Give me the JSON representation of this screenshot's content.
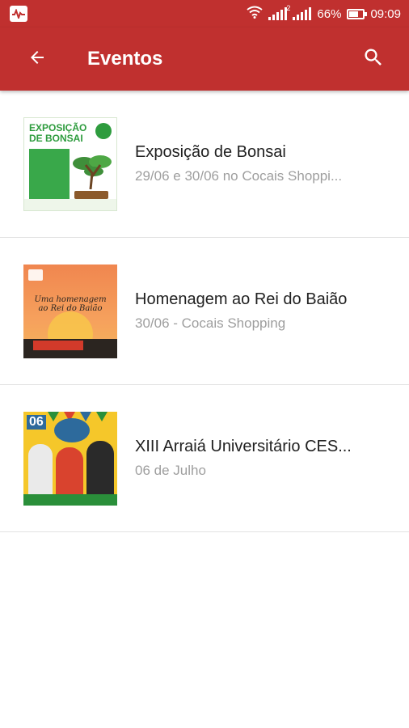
{
  "status_bar": {
    "battery": "66%",
    "time": "09:09",
    "sim2_label": "2",
    "battery_level": 0.66
  },
  "app_bar": {
    "title": "Eventos",
    "back_icon": "arrow-back-icon",
    "search_icon": "search-icon"
  },
  "colors": {
    "primary": "#c0302f",
    "title_text": "#212121",
    "subtitle_text": "#9e9e9e"
  },
  "events": [
    {
      "title": "Exposição de Bonsai",
      "subtitle": "29/06 e 30/06 no Cocais Shoppi...",
      "poster": {
        "line1": "EXPOSIÇÃO",
        "line2": "DE BONSAI"
      }
    },
    {
      "title": "Homenagem ao Rei do Baião",
      "subtitle": "30/06 - Cocais Shopping",
      "poster": {
        "line1": "Uma homenagem",
        "line2": "ao Rei do Baião"
      }
    },
    {
      "title": "XIII Arraiá Universitário CES...",
      "subtitle": "06 de Julho",
      "poster": {
        "date": "06"
      }
    }
  ]
}
